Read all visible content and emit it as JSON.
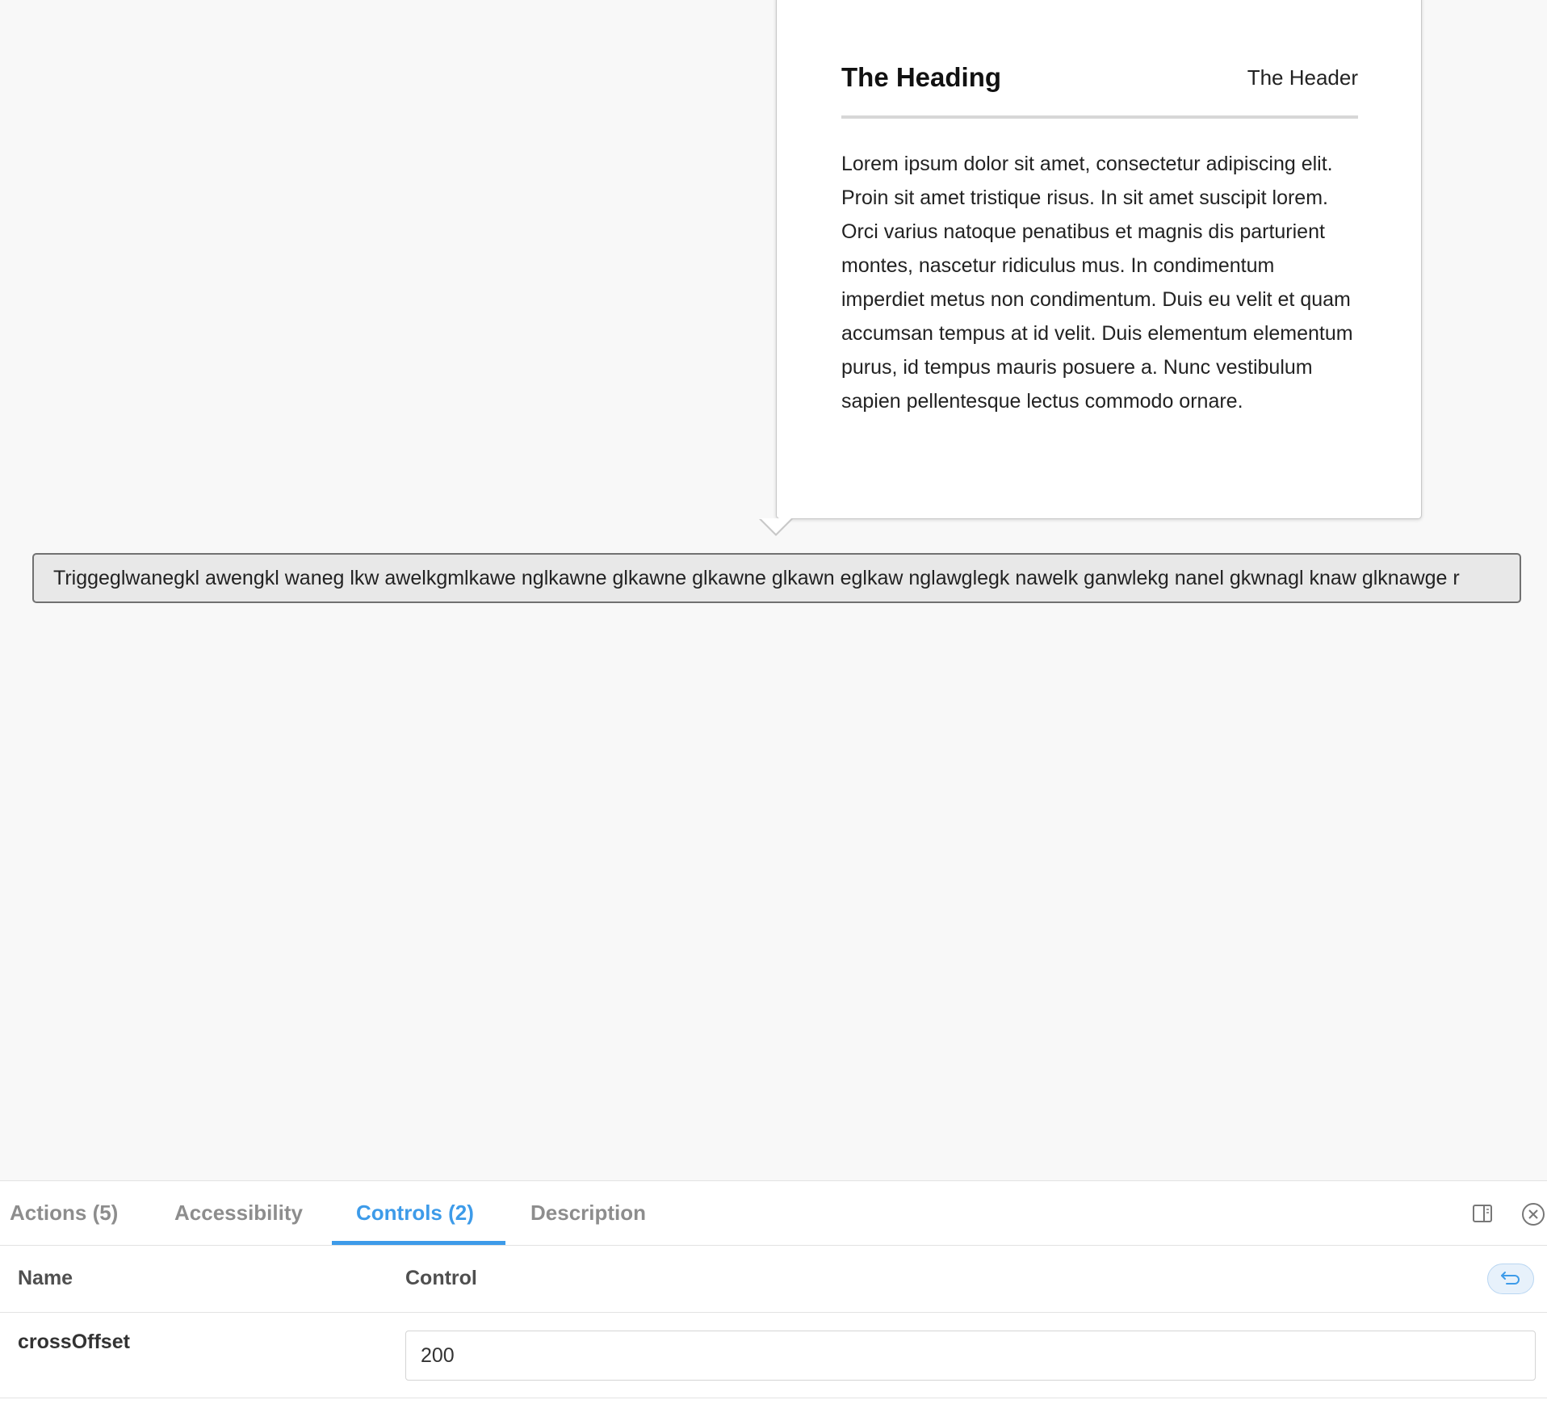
{
  "popover": {
    "heading": "The Heading",
    "header": "The Header",
    "body": "Lorem ipsum dolor sit amet, consectetur adipiscing elit. Proin sit amet tristique risus. In sit amet suscipit lorem. Orci varius natoque penatibus et magnis dis parturient montes, nascetur ridiculus mus. In condimentum imperdiet metus non condimentum. Duis eu velit et quam accumsan tempus at id velit. Duis elementum elementum purus, id tempus mauris posuere a. Nunc vestibulum sapien pellentesque lectus commodo ornare."
  },
  "trigger": {
    "label": "Triggeglwanegkl awengkl waneg lkw awelkgmlkawe nglkawne glkawne glkawne glkawn eglkaw nglawglegk nawelk ganwlekg nanel gkwnagl knaw glknawge r"
  },
  "panel": {
    "tabs": [
      {
        "label": "Actions (5)",
        "active": false
      },
      {
        "label": "Accessibility",
        "active": false
      },
      {
        "label": "Controls (2)",
        "active": true
      },
      {
        "label": "Description",
        "active": false
      }
    ],
    "icons": {
      "toggle": "panel-orientation-icon",
      "close": "close-icon",
      "reset": "undo-icon"
    },
    "accent_color": "#3d9be9",
    "table": {
      "headers": [
        "Name",
        "Control"
      ],
      "rows": [
        {
          "name": "crossOffset",
          "value": "200"
        }
      ]
    }
  }
}
